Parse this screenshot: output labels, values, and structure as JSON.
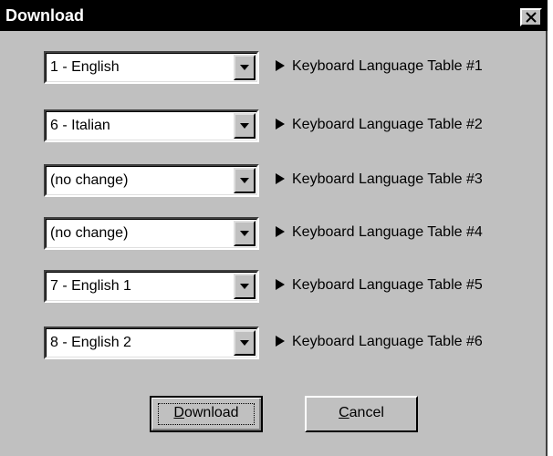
{
  "window": {
    "title": "Download",
    "close_glyph": "✕"
  },
  "rows": [
    {
      "value": "1 - English",
      "label": "Keyboard Language Table #1"
    },
    {
      "value": "6 - Italian",
      "label": "Keyboard Language Table #2"
    },
    {
      "value": "(no change)",
      "label": "Keyboard Language Table #3"
    },
    {
      "value": "(no change)",
      "label": "Keyboard Language Table #4"
    },
    {
      "value": "7 - English 1",
      "label": "Keyboard Language Table #5"
    },
    {
      "value": "8 - English 2",
      "label": "Keyboard Language Table #6"
    }
  ],
  "buttons": {
    "download": {
      "mnemonic": "D",
      "rest": "ownload"
    },
    "cancel": {
      "mnemonic": "C",
      "rest": "ancel"
    }
  },
  "colors": {
    "dialog_bg": "#c0c0c0",
    "titlebar_bg": "#000000",
    "titlebar_text": "#ffffff"
  },
  "icons": {
    "row_bullet": "right-triangle-icon",
    "dropdown": "chevron-down-icon",
    "close": "close-icon"
  }
}
